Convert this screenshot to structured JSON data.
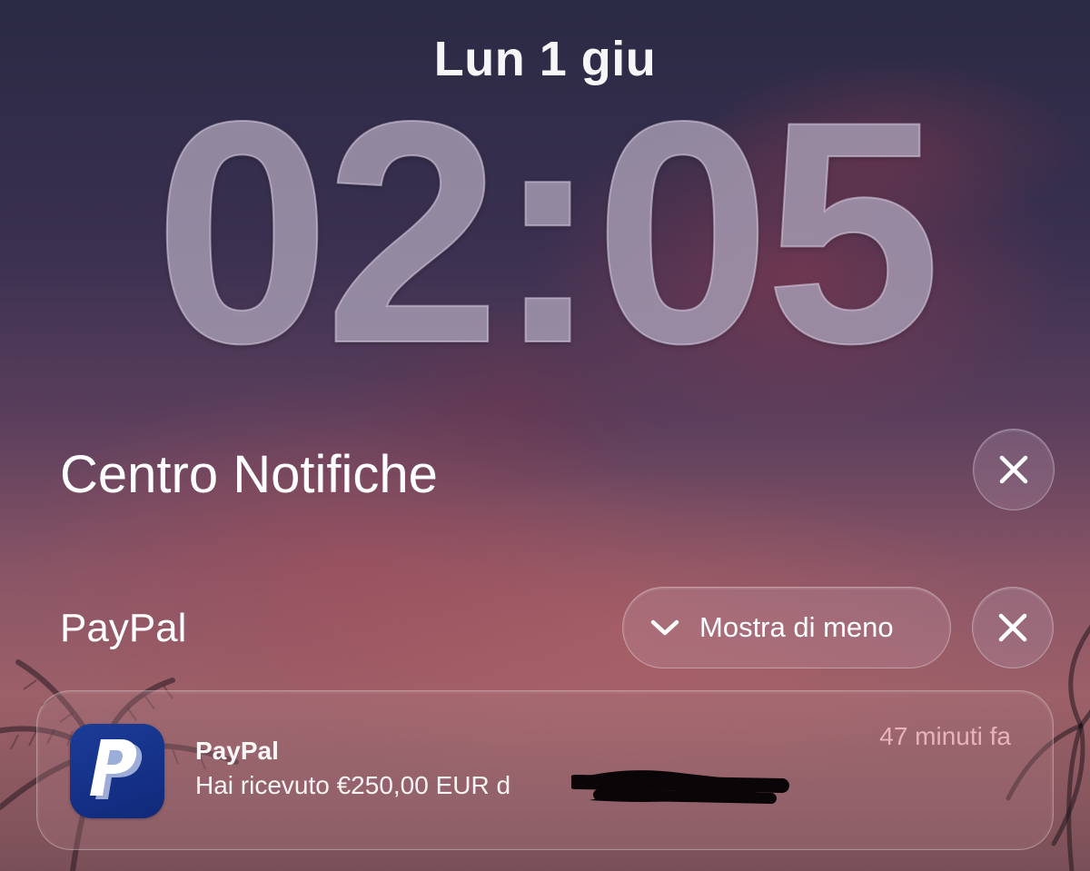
{
  "lock_screen": {
    "date": "Lun 1 giu",
    "time": "02:05"
  },
  "notification_center": {
    "title": "Centro Notifiche",
    "close_icon": "close-icon"
  },
  "group": {
    "app_name": "PayPal",
    "show_less_label": "Mostra di meno",
    "show_less_icon": "chevron-down-icon",
    "close_icon": "close-icon"
  },
  "notification": {
    "app_name": "PayPal",
    "message": "Hai ricevuto €250,00 EUR d",
    "time": "47 minuti fa",
    "icon": "paypal-logo",
    "icon_bg": "#1b3c98",
    "icon_letter_dark": "#ffffff",
    "icon_letter_light": "#c9d6f2"
  }
}
